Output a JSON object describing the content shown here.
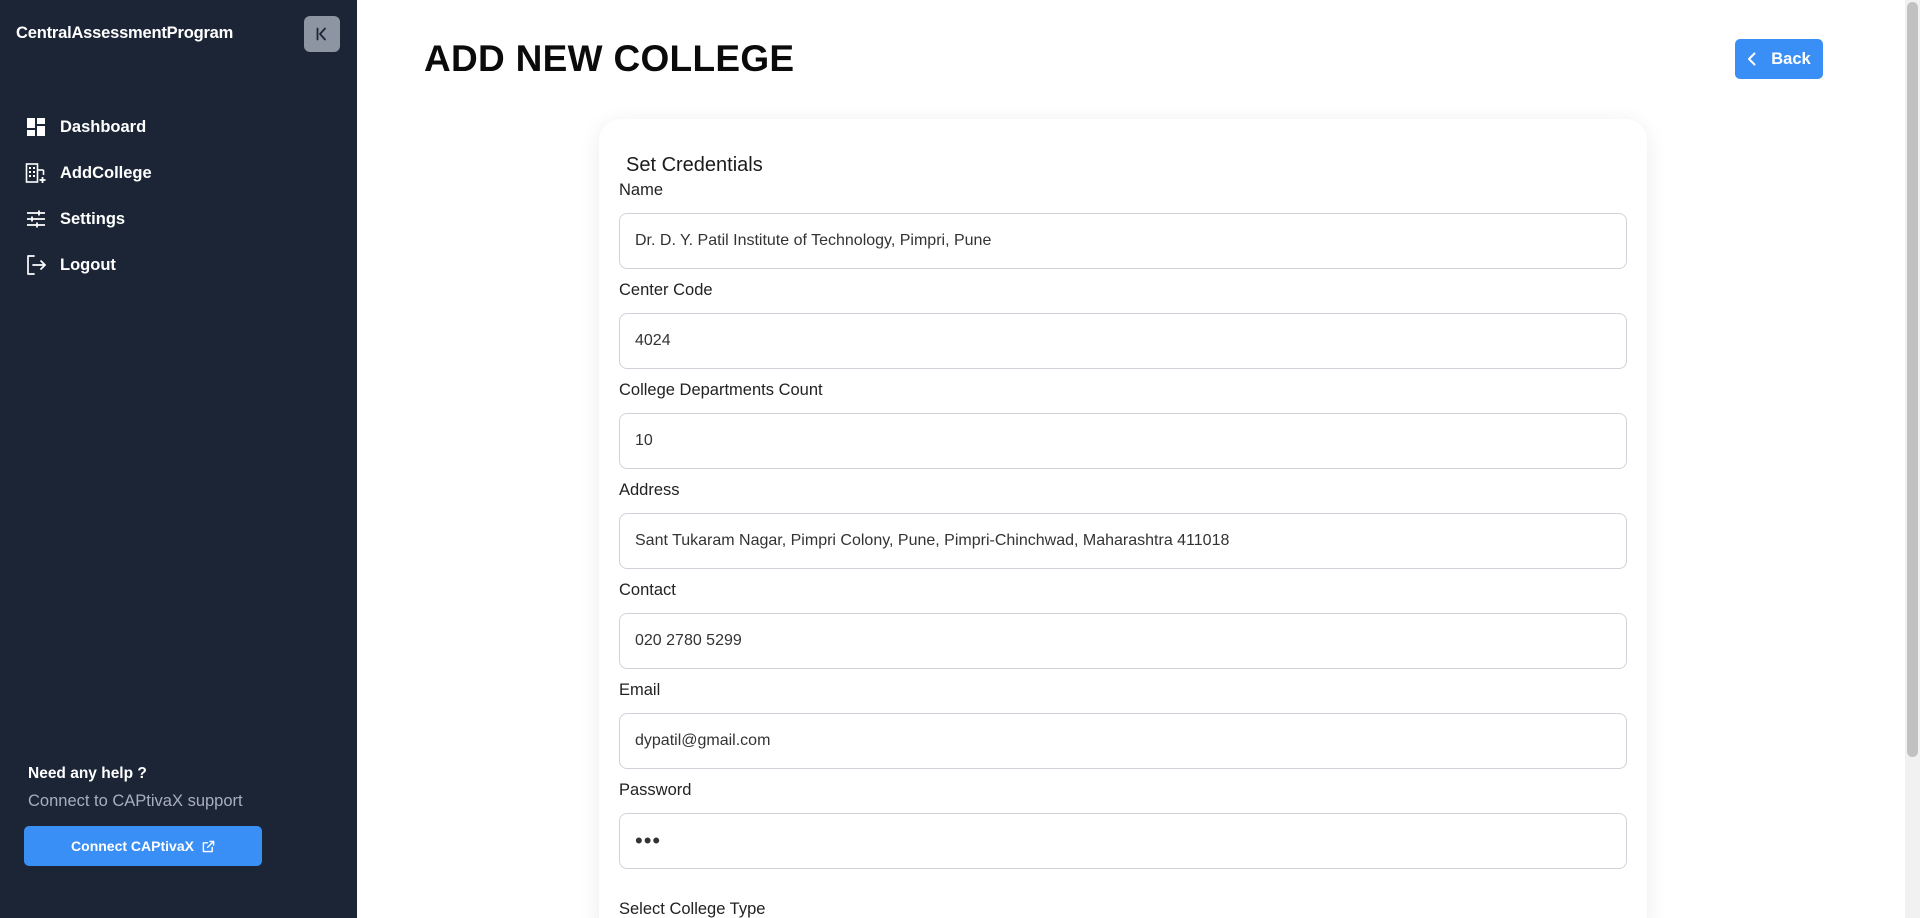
{
  "sidebar": {
    "brand": "CentralAssessmentProgram",
    "items": [
      {
        "label": "Dashboard",
        "icon": "dashboard-icon"
      },
      {
        "label": "AddCollege",
        "icon": "building-add-icon"
      },
      {
        "label": "Settings",
        "icon": "sliders-icon"
      },
      {
        "label": "Logout",
        "icon": "logout-icon"
      }
    ],
    "help": {
      "title": "Need any help ?",
      "subtitle": "Connect to CAPtivaX support",
      "button_label": "Connect CAPtivaX"
    }
  },
  "header": {
    "title": "ADD NEW COLLEGE",
    "back_label": "Back"
  },
  "form": {
    "section_title": "Set Credentials",
    "fields": [
      {
        "label": "Name",
        "value": "Dr. D. Y. Patil Institute of Technology, Pimpri, Pune"
      },
      {
        "label": "Center Code",
        "value": "4024"
      },
      {
        "label": "College Departments Count",
        "value": "10"
      },
      {
        "label": "Address",
        "value": "Sant Tukaram Nagar, Pimpri Colony, Pune, Pimpri-Chinchwad, Maharashtra 411018"
      },
      {
        "label": "Contact",
        "value": "020 2780 5299"
      },
      {
        "label": "Email",
        "value": "dypatil@gmail.com"
      },
      {
        "label": "Password",
        "value": "•••"
      }
    ],
    "select_label": "Select College Type"
  },
  "colors": {
    "sidebar_bg": "#1c2536",
    "accent": "#3a8ff6",
    "help_subtitle": "#a7afbd"
  }
}
